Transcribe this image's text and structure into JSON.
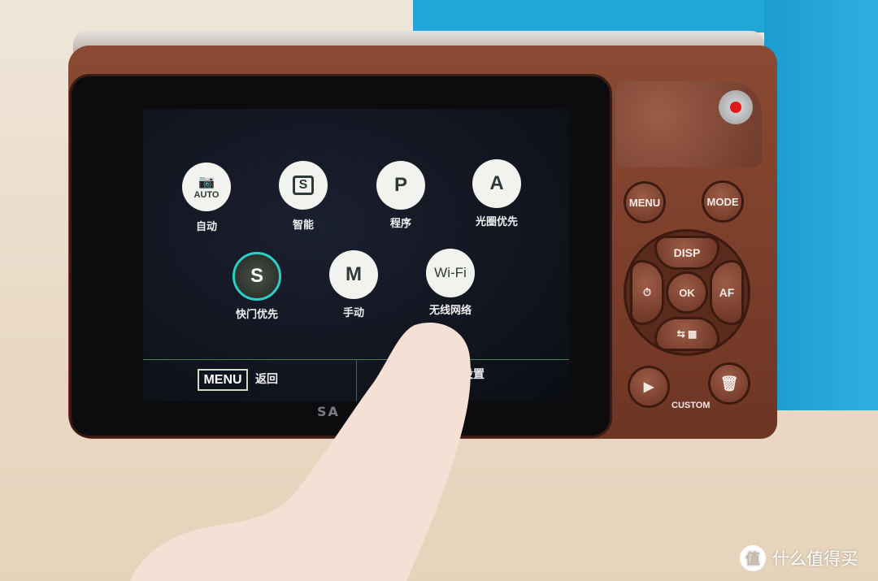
{
  "screen": {
    "modes": [
      {
        "label": "自动",
        "icon": "camera-auto-icon",
        "text": "AUTO",
        "selected": false
      },
      {
        "label": "智能",
        "icon": "camera-smart-icon",
        "text": "S",
        "selected": false
      },
      {
        "label": "程序",
        "icon": "program-icon",
        "text": "P",
        "selected": false
      },
      {
        "label": "光圈优先",
        "icon": "aperture-priority-icon",
        "text": "A",
        "selected": false
      },
      {
        "label": "快门优先",
        "icon": "shutter-priority-icon",
        "text": "S",
        "selected": true
      },
      {
        "label": "手动",
        "icon": "manual-icon",
        "text": "M",
        "selected": false
      },
      {
        "label": "无线网络",
        "icon": "wifi-icon",
        "text": "Wi-Fi",
        "selected": false
      }
    ],
    "bottom": {
      "menu_key": "MENU",
      "back": "返回",
      "settings": "设置"
    },
    "accent": "#2ad0c8"
  },
  "camera": {
    "brand_partial": "SA",
    "buttons": {
      "menu": "MENU",
      "mode": "MODE",
      "disp": "DISP",
      "ok": "OK",
      "af": "AF",
      "custom": "CUSTOM"
    }
  },
  "watermark": {
    "logo": "值",
    "text": "什么值得买"
  }
}
